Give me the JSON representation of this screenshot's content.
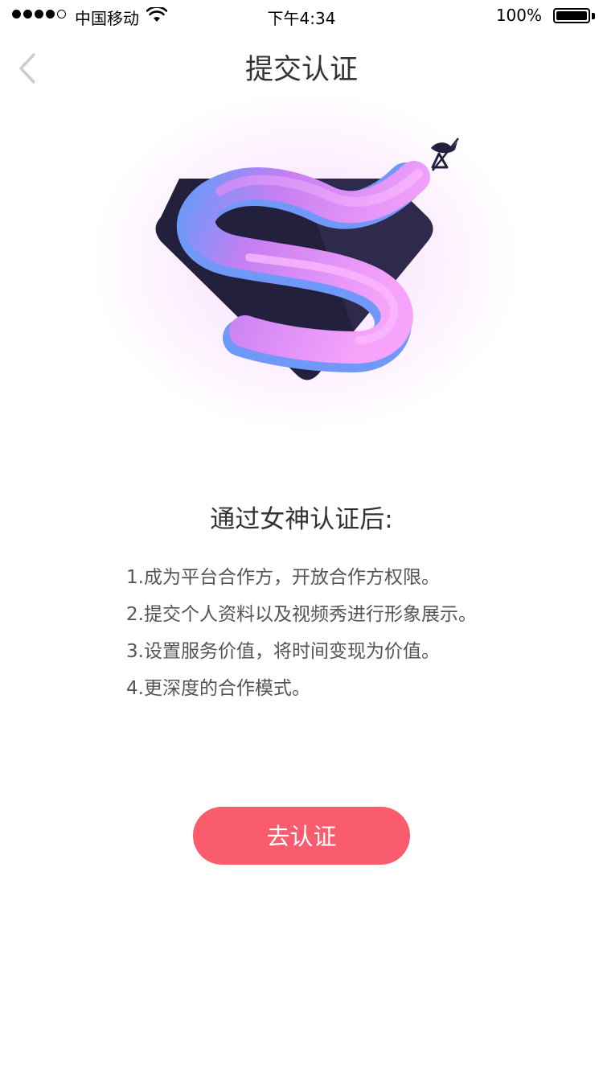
{
  "status_bar": {
    "carrier": "中国移动",
    "time": "下午4:34",
    "battery_percent": "100%",
    "signal_bars_filled": 4,
    "signal_bars_total": 5,
    "battery_level": 1.0
  },
  "nav": {
    "title": "提交认证",
    "back_icon": "chevron-left-icon"
  },
  "logo": {
    "icon": "goddess-s-diamond-logo"
  },
  "content": {
    "headline": "通过女神认证后:",
    "benefits": [
      "1.成为平台合作方，开放合作方权限。",
      "2.提交个人资料以及视频秀进行形象展示。",
      "3.设置服务价值，将时间变现为价值。",
      "4.更深度的合作模式。"
    ]
  },
  "cta": {
    "label": "去认证"
  },
  "colors": {
    "accent": "#f95c6d",
    "shield": "#22203d",
    "ribbon_pink": "#f39dfa",
    "ribbon_purple": "#c77ef2",
    "ribbon_blue": "#6f98f8"
  }
}
